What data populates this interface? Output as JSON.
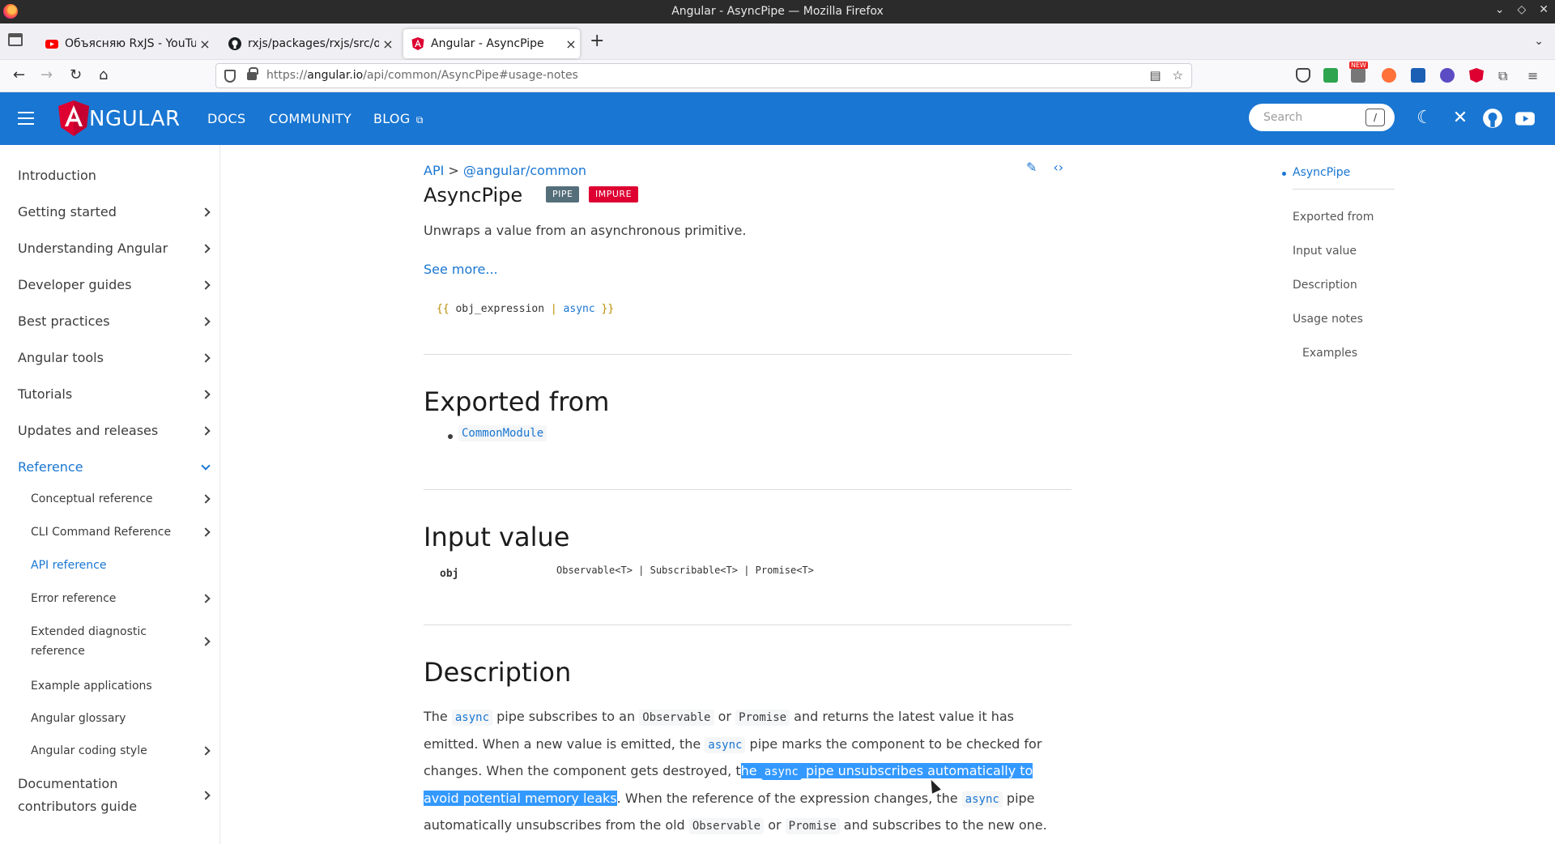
{
  "window": {
    "title": "Angular - AsyncPipe — Mozilla Firefox"
  },
  "tabs": [
    {
      "label": "Объясняю RxJS - YouTube",
      "icon": "youtube-icon",
      "active": false
    },
    {
      "label": "rxjs/packages/rxjs/src/op",
      "icon": "github-icon",
      "active": false
    },
    {
      "label": "Angular - AsyncPipe",
      "icon": "angular-icon",
      "active": true
    }
  ],
  "toolbar": {
    "url_prefix": "https://",
    "url_host": "angular.io",
    "url_path": "/api/common/AsyncPipe#usage-notes",
    "ext_badge_new": "NEW"
  },
  "header": {
    "brand": "NGULAR",
    "nav": [
      "DOCS",
      "COMMUNITY",
      "BLOG"
    ],
    "search_placeholder": "Search",
    "search_shortcut": "/"
  },
  "sidebar": {
    "items": [
      {
        "label": "Introduction"
      },
      {
        "label": "Getting started"
      },
      {
        "label": "Understanding Angular"
      },
      {
        "label": "Developer guides"
      },
      {
        "label": "Best practices"
      },
      {
        "label": "Angular tools"
      },
      {
        "label": "Tutorials"
      },
      {
        "label": "Updates and releases"
      },
      {
        "label": "Reference"
      }
    ],
    "subitems": [
      {
        "label": "Conceptual reference"
      },
      {
        "label": "CLI Command Reference"
      },
      {
        "label": "API reference"
      },
      {
        "label": "Error reference"
      },
      {
        "label": "Extended diagnostic reference"
      },
      {
        "label": "Example applications"
      },
      {
        "label": "Angular glossary"
      },
      {
        "label": "Angular coding style"
      }
    ],
    "footer_item": {
      "label": "Documentation contributors guide"
    }
  },
  "content": {
    "breadcrumb": {
      "root": "API",
      "sep": ">",
      "pkg": "@angular/common"
    },
    "title": "AsyncPipe",
    "badges": {
      "pipe": "PIPE",
      "impure": "IMPURE"
    },
    "lead": "Unwraps a value from an asynchronous primitive.",
    "see_more": "See more...",
    "signature": {
      "open": "{{",
      "expr": "obj_expression",
      "bar": "|",
      "pipe": "async",
      "close": "}}"
    },
    "exported_from": {
      "heading": "Exported from",
      "module": "CommonModule"
    },
    "input_value": {
      "heading": "Input value",
      "name": "obj",
      "type": "Observable<T> | Subscribable<T> | Promise<T>"
    },
    "description": {
      "heading": "Description",
      "p1": "The",
      "c1": "async",
      "p2": "pipe subscribes to an",
      "c2": "Observable",
      "p3": "or",
      "c3": "Promise",
      "p4": "and returns the latest value it has emitted. When a new value is emitted, the",
      "c4": "async",
      "p5": "pipe marks the component to be checked for changes. When the component gets destroyed, t",
      "s1": "he",
      "sc": "async",
      "s2": "pipe unsubscribes automatically to avoid potential memory leaks",
      "p6": ". When the reference of the expression changes, the",
      "c5": "async",
      "p7": "pipe automatically unsubscribes from the old",
      "c6": "Observable",
      "p8": "or",
      "c7": "Promise",
      "p9": "and subscribes to the new one."
    }
  },
  "toc": {
    "items": [
      "AsyncPipe",
      "Exported from",
      "Input value",
      "Description",
      "Usage notes",
      "Examples"
    ]
  },
  "colors": {
    "brand_blue": "#1976d2",
    "badge_pipe": "#546e7a",
    "badge_impure": "#dd0031",
    "selection": "#3399ff"
  }
}
